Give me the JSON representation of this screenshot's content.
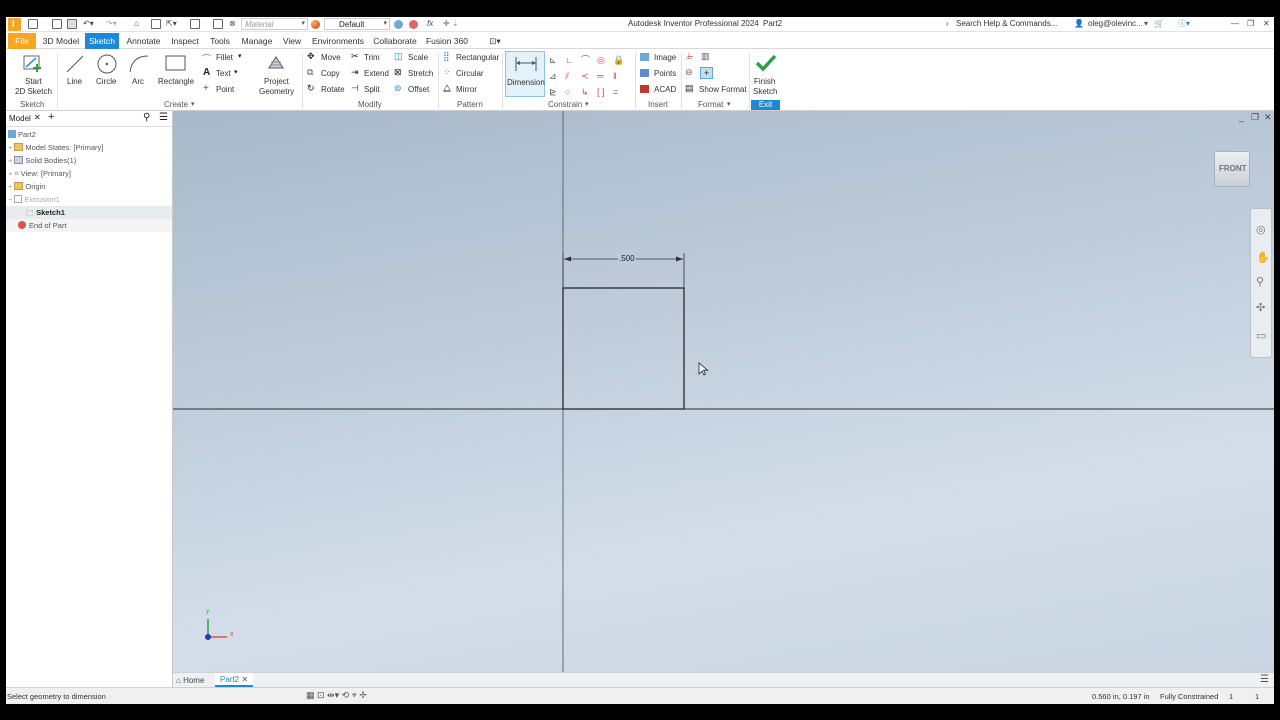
{
  "titlebar": {
    "app_title": "Autodesk Inventor Professional 2024",
    "doc_name": "Part2",
    "material_placeholder": "Material",
    "appearance_value": "Default",
    "search_placeholder": "Search Help & Commands...",
    "user": "oleg@olevinc...",
    "fx_label": "fx"
  },
  "menu": {
    "tabs": [
      "File",
      "3D Model",
      "Sketch",
      "Annotate",
      "Inspect",
      "Tools",
      "Manage",
      "View",
      "Environments",
      "Collaborate",
      "Fusion 360"
    ],
    "active": "Sketch"
  },
  "ribbon": {
    "sketch": {
      "start1": "Start",
      "start2": "2D Sketch",
      "group": "Sketch"
    },
    "create": {
      "line": "Line",
      "circle": "Circle",
      "arc": "Arc",
      "rectangle": "Rectangle",
      "fillet": "Fillet",
      "text": "Text",
      "point": "Point",
      "project1": "Project",
      "project2": "Geometry",
      "group": "Create"
    },
    "modify": {
      "move": "Move",
      "trim": "Trim",
      "scale": "Scale",
      "copy": "Copy",
      "extend": "Extend",
      "stretch": "Stretch",
      "rotate": "Rotate",
      "split": "Split",
      "offset": "Offset",
      "group": "Modify"
    },
    "pattern": {
      "rectangular": "Rectangular",
      "circular": "Circular",
      "mirror": "Mirror",
      "group": "Pattern"
    },
    "constrain": {
      "dimension": "Dimension",
      "group": "Constrain"
    },
    "insert": {
      "image": "Image",
      "points": "Points",
      "acad": "ACAD",
      "group": "Insert"
    },
    "format": {
      "show_format": "Show Format",
      "group": "Format"
    },
    "exit": {
      "finish1": "Finish",
      "finish2": "Sketch",
      "group": "Exit"
    }
  },
  "browser": {
    "tab": "Model",
    "items": [
      {
        "label": "Part2"
      },
      {
        "label": "Model States: [Primary]"
      },
      {
        "label": "Solid Bodies(1)"
      },
      {
        "label": "View: [Primary]"
      },
      {
        "label": "Origin"
      },
      {
        "label": "Extrusion1"
      },
      {
        "label": "Sketch1"
      },
      {
        "label": "End of Part"
      }
    ]
  },
  "canvas": {
    "viewcube_label": "FRONT",
    "dimension_value": ".500",
    "triad_y": "y",
    "triad_x": "x"
  },
  "doc_tabs": {
    "home": "Home",
    "part": "Part2"
  },
  "status": {
    "prompt": "Select geometry to dimension",
    "coords": "0.560 in, 0.197 in",
    "constraint_state": "Fully Constrained",
    "count1": "1",
    "count2": "1"
  },
  "colors": {
    "file_tab": "#f5a623",
    "active_tab": "#1e88d5",
    "finish_check": "#2ea043",
    "canvas_top": "#a8b9cb",
    "canvas_bottom": "#d4deea"
  }
}
